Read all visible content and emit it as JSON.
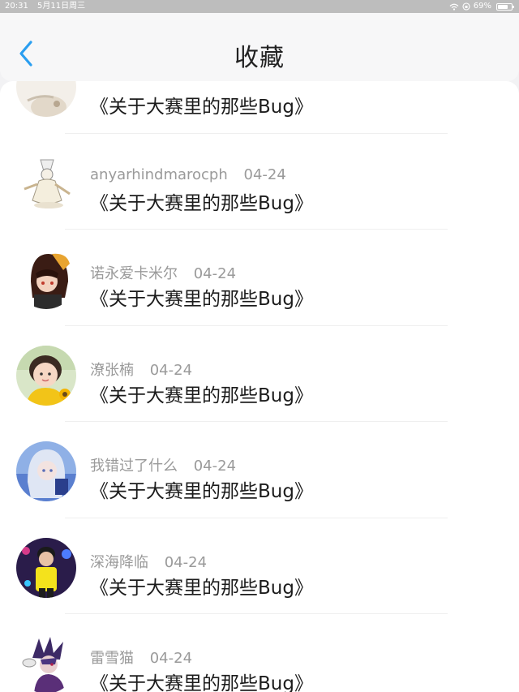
{
  "status_bar": {
    "time": "20:31",
    "date": "5月11日周三",
    "battery": "69%"
  },
  "header": {
    "title": "收藏",
    "back_icon": "chevron-left-icon",
    "accent_color": "#2a9ef0"
  },
  "favorites": [
    {
      "author": "",
      "date": "",
      "post_title": "《关于大赛里的那些Bug》"
    },
    {
      "author": "anyarhindmarocph",
      "date": "04-24",
      "post_title": "《关于大赛里的那些Bug》"
    },
    {
      "author": "诺永爱卡米尔",
      "date": "04-24",
      "post_title": "《关于大赛里的那些Bug》"
    },
    {
      "author": "潦张楠",
      "date": "04-24",
      "post_title": "《关于大赛里的那些Bug》"
    },
    {
      "author": "我错过了什么",
      "date": "04-24",
      "post_title": "《关于大赛里的那些Bug》"
    },
    {
      "author": "深海降临",
      "date": "04-24",
      "post_title": "《关于大赛里的那些Bug》"
    },
    {
      "author": "雷雪猫",
      "date": "04-24",
      "post_title": "《关于大赛里的那些Bug》"
    }
  ]
}
